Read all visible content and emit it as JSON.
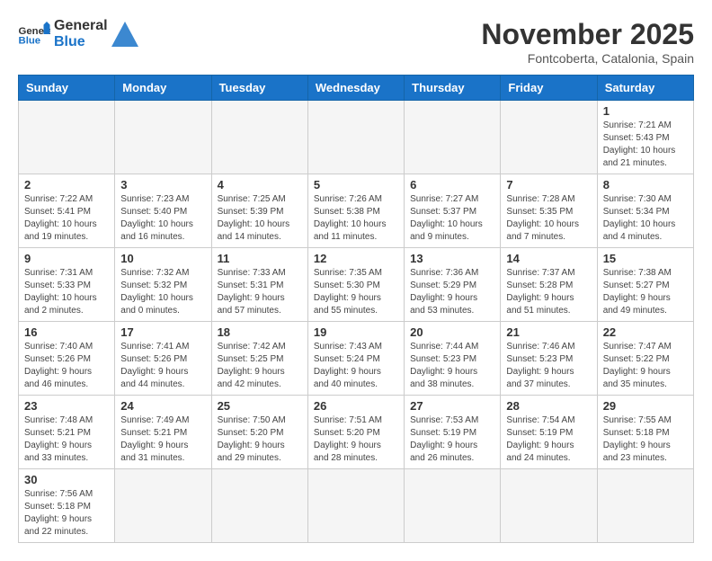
{
  "header": {
    "logo_general": "General",
    "logo_blue": "Blue",
    "month_title": "November 2025",
    "subtitle": "Fontcoberta, Catalonia, Spain"
  },
  "days_of_week": [
    "Sunday",
    "Monday",
    "Tuesday",
    "Wednesday",
    "Thursday",
    "Friday",
    "Saturday"
  ],
  "weeks": [
    [
      {
        "day": "",
        "info": ""
      },
      {
        "day": "",
        "info": ""
      },
      {
        "day": "",
        "info": ""
      },
      {
        "day": "",
        "info": ""
      },
      {
        "day": "",
        "info": ""
      },
      {
        "day": "",
        "info": ""
      },
      {
        "day": "1",
        "info": "Sunrise: 7:21 AM\nSunset: 5:43 PM\nDaylight: 10 hours and 21 minutes."
      }
    ],
    [
      {
        "day": "2",
        "info": "Sunrise: 7:22 AM\nSunset: 5:41 PM\nDaylight: 10 hours and 19 minutes."
      },
      {
        "day": "3",
        "info": "Sunrise: 7:23 AM\nSunset: 5:40 PM\nDaylight: 10 hours and 16 minutes."
      },
      {
        "day": "4",
        "info": "Sunrise: 7:25 AM\nSunset: 5:39 PM\nDaylight: 10 hours and 14 minutes."
      },
      {
        "day": "5",
        "info": "Sunrise: 7:26 AM\nSunset: 5:38 PM\nDaylight: 10 hours and 11 minutes."
      },
      {
        "day": "6",
        "info": "Sunrise: 7:27 AM\nSunset: 5:37 PM\nDaylight: 10 hours and 9 minutes."
      },
      {
        "day": "7",
        "info": "Sunrise: 7:28 AM\nSunset: 5:35 PM\nDaylight: 10 hours and 7 minutes."
      },
      {
        "day": "8",
        "info": "Sunrise: 7:30 AM\nSunset: 5:34 PM\nDaylight: 10 hours and 4 minutes."
      }
    ],
    [
      {
        "day": "9",
        "info": "Sunrise: 7:31 AM\nSunset: 5:33 PM\nDaylight: 10 hours and 2 minutes."
      },
      {
        "day": "10",
        "info": "Sunrise: 7:32 AM\nSunset: 5:32 PM\nDaylight: 10 hours and 0 minutes."
      },
      {
        "day": "11",
        "info": "Sunrise: 7:33 AM\nSunset: 5:31 PM\nDaylight: 9 hours and 57 minutes."
      },
      {
        "day": "12",
        "info": "Sunrise: 7:35 AM\nSunset: 5:30 PM\nDaylight: 9 hours and 55 minutes."
      },
      {
        "day": "13",
        "info": "Sunrise: 7:36 AM\nSunset: 5:29 PM\nDaylight: 9 hours and 53 minutes."
      },
      {
        "day": "14",
        "info": "Sunrise: 7:37 AM\nSunset: 5:28 PM\nDaylight: 9 hours and 51 minutes."
      },
      {
        "day": "15",
        "info": "Sunrise: 7:38 AM\nSunset: 5:27 PM\nDaylight: 9 hours and 49 minutes."
      }
    ],
    [
      {
        "day": "16",
        "info": "Sunrise: 7:40 AM\nSunset: 5:26 PM\nDaylight: 9 hours and 46 minutes."
      },
      {
        "day": "17",
        "info": "Sunrise: 7:41 AM\nSunset: 5:26 PM\nDaylight: 9 hours and 44 minutes."
      },
      {
        "day": "18",
        "info": "Sunrise: 7:42 AM\nSunset: 5:25 PM\nDaylight: 9 hours and 42 minutes."
      },
      {
        "day": "19",
        "info": "Sunrise: 7:43 AM\nSunset: 5:24 PM\nDaylight: 9 hours and 40 minutes."
      },
      {
        "day": "20",
        "info": "Sunrise: 7:44 AM\nSunset: 5:23 PM\nDaylight: 9 hours and 38 minutes."
      },
      {
        "day": "21",
        "info": "Sunrise: 7:46 AM\nSunset: 5:23 PM\nDaylight: 9 hours and 37 minutes."
      },
      {
        "day": "22",
        "info": "Sunrise: 7:47 AM\nSunset: 5:22 PM\nDaylight: 9 hours and 35 minutes."
      }
    ],
    [
      {
        "day": "23",
        "info": "Sunrise: 7:48 AM\nSunset: 5:21 PM\nDaylight: 9 hours and 33 minutes."
      },
      {
        "day": "24",
        "info": "Sunrise: 7:49 AM\nSunset: 5:21 PM\nDaylight: 9 hours and 31 minutes."
      },
      {
        "day": "25",
        "info": "Sunrise: 7:50 AM\nSunset: 5:20 PM\nDaylight: 9 hours and 29 minutes."
      },
      {
        "day": "26",
        "info": "Sunrise: 7:51 AM\nSunset: 5:20 PM\nDaylight: 9 hours and 28 minutes."
      },
      {
        "day": "27",
        "info": "Sunrise: 7:53 AM\nSunset: 5:19 PM\nDaylight: 9 hours and 26 minutes."
      },
      {
        "day": "28",
        "info": "Sunrise: 7:54 AM\nSunset: 5:19 PM\nDaylight: 9 hours and 24 minutes."
      },
      {
        "day": "29",
        "info": "Sunrise: 7:55 AM\nSunset: 5:18 PM\nDaylight: 9 hours and 23 minutes."
      }
    ],
    [
      {
        "day": "30",
        "info": "Sunrise: 7:56 AM\nSunset: 5:18 PM\nDaylight: 9 hours and 22 minutes."
      },
      {
        "day": "",
        "info": ""
      },
      {
        "day": "",
        "info": ""
      },
      {
        "day": "",
        "info": ""
      },
      {
        "day": "",
        "info": ""
      },
      {
        "day": "",
        "info": ""
      },
      {
        "day": "",
        "info": ""
      }
    ]
  ]
}
